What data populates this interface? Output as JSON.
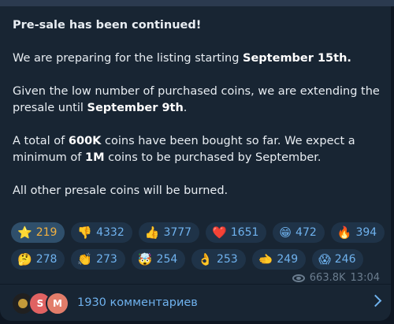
{
  "message": {
    "title": "Pre-sale has been continued!",
    "p1_pre": "We are preparing for the listing starting ",
    "p1_bold": "September 15th.",
    "p2_pre": "Given the low number of purchased coins, we are extending the presale until ",
    "p2_bold": "September 9th",
    "p2_post": ".",
    "p3_pre": "A total of ",
    "p3_bold1": "600K",
    "p3_mid1": " coins have been bought so far. We expect a minimum of ",
    "p3_bold2": "1M",
    "p3_post": " coins to be purchased by September.",
    "p4": "All other presale coins will be burned."
  },
  "reactions": {
    "row1": [
      {
        "emoji": "⭐",
        "icon": "star-icon",
        "count": "219",
        "active": true
      },
      {
        "emoji": "👎",
        "icon": "thumbs-down-icon",
        "count": "4332"
      },
      {
        "emoji": "👍",
        "icon": "thumbs-up-icon",
        "count": "3777"
      },
      {
        "emoji": "❤️",
        "icon": "heart-icon",
        "count": "1651"
      },
      {
        "emoji": "😁",
        "icon": "grin-icon",
        "count": "472"
      },
      {
        "emoji": "🔥",
        "icon": "fire-icon",
        "count": "394"
      }
    ],
    "row2": [
      {
        "emoji": "🤔",
        "icon": "thinking-face-icon",
        "count": "278"
      },
      {
        "emoji": "👏",
        "icon": "clapping-hands-icon",
        "count": "273"
      },
      {
        "emoji": "🤯",
        "icon": "exploding-head-icon",
        "count": "254"
      },
      {
        "emoji": "👌",
        "icon": "ok-hand-icon",
        "count": "253"
      },
      {
        "emoji": "🫲",
        "icon": "pointing-hand-icon",
        "count": "249"
      },
      {
        "emoji": "😱",
        "icon": "screaming-face-icon",
        "count": "246"
      }
    ]
  },
  "meta": {
    "views": "663.8K",
    "time": "13:04"
  },
  "comments": {
    "label": "1930 комментариев",
    "avatars": [
      "",
      "S",
      "M"
    ]
  },
  "colors": {
    "background": "#0e1621",
    "bubble": "#182533",
    "accent": "#6fb2ee",
    "star": "#f2b141"
  }
}
